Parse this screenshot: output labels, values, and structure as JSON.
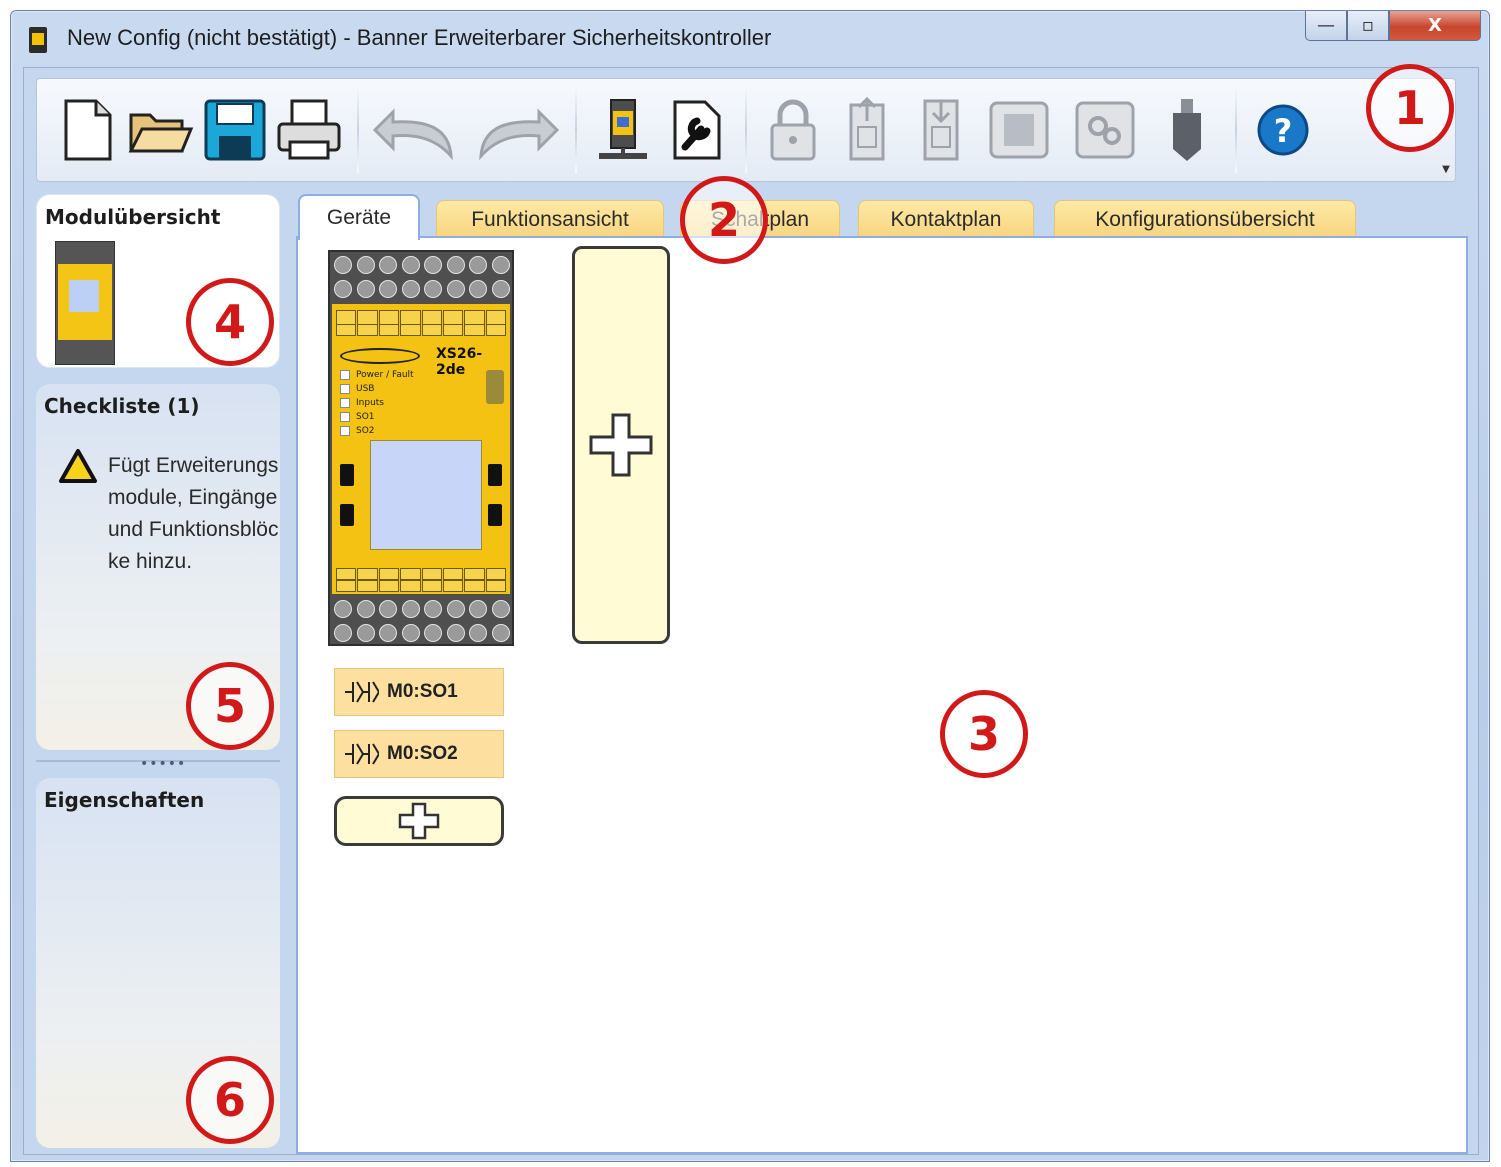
{
  "window": {
    "title": "New Config (nicht bestätigt) - Banner Erweiterbarer Sicherheitskontroller",
    "caption": {
      "minimize": "—",
      "maximize": "▫",
      "close": "X"
    }
  },
  "toolbar": {
    "buttons": [
      {
        "icon": "new-file-icon"
      },
      {
        "icon": "open-folder-icon"
      },
      {
        "icon": "save-icon"
      },
      {
        "icon": "print-icon"
      },
      {
        "icon": "undo-icon"
      },
      {
        "icon": "redo-icon"
      },
      {
        "icon": "device-module-icon"
      },
      {
        "icon": "settings-document-icon"
      },
      {
        "icon": "lock-icon"
      },
      {
        "icon": "upload-to-controller-icon"
      },
      {
        "icon": "download-from-controller-icon"
      },
      {
        "icon": "module-chip-icon"
      },
      {
        "icon": "network-gears-icon"
      },
      {
        "icon": "usb-stick-icon"
      },
      {
        "icon": "help-icon"
      }
    ]
  },
  "sidebar": {
    "module_overview_title": "Modulübersicht",
    "checklist_title": "Checkliste (1)",
    "checklist_item": "Fügt Erweiterungsmodule, Eingänge und Funktionsblöcke hinzu.",
    "grip": "•••••",
    "properties_title": "Eigenschaften"
  },
  "tabs": [
    {
      "label": "Geräte",
      "active": true
    },
    {
      "label": "Funktionsansicht",
      "active": false
    },
    {
      "label": "Schaltplan",
      "active": false
    },
    {
      "label": "Kontaktplan",
      "active": false
    },
    {
      "label": "Konfigurationsübersicht",
      "active": false
    }
  ],
  "device": {
    "model": "XS26-2de",
    "leds": [
      "Power / Fault",
      "USB",
      "Inputs",
      "SO1",
      "SO2"
    ]
  },
  "outputs": [
    {
      "label": "M0:SO1"
    },
    {
      "label": "M0:SO2"
    }
  ],
  "callouts": [
    "1",
    "2",
    "3",
    "4",
    "5",
    "6"
  ],
  "colors": {
    "callout": "#d21919",
    "tab_inactive": "#fde9a6",
    "device_yellow": "#f3c212",
    "add_slot": "#fffbd4"
  }
}
